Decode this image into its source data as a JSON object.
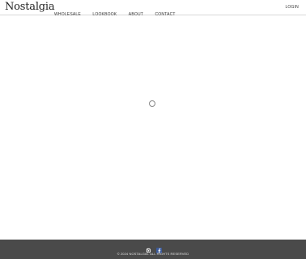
{
  "header": {
    "logo": "Nostalgia",
    "nav": [
      "WHOLESALE",
      "LOOKBOOK",
      "ABOUT",
      "CONTACT"
    ],
    "login": "LOGIN"
  },
  "main": {
    "state": "loading",
    "spinner_icon": "loading-spinner-icon"
  },
  "footer": {
    "social_icons": [
      "instagram-icon",
      "facebook-icon"
    ],
    "copyright": "© 2024 NOSTALGIA. ALL RIGHTS RESERVED"
  },
  "colors": {
    "footer_bg": "#4a4a4a",
    "facebook_blue": "#3b5998"
  }
}
